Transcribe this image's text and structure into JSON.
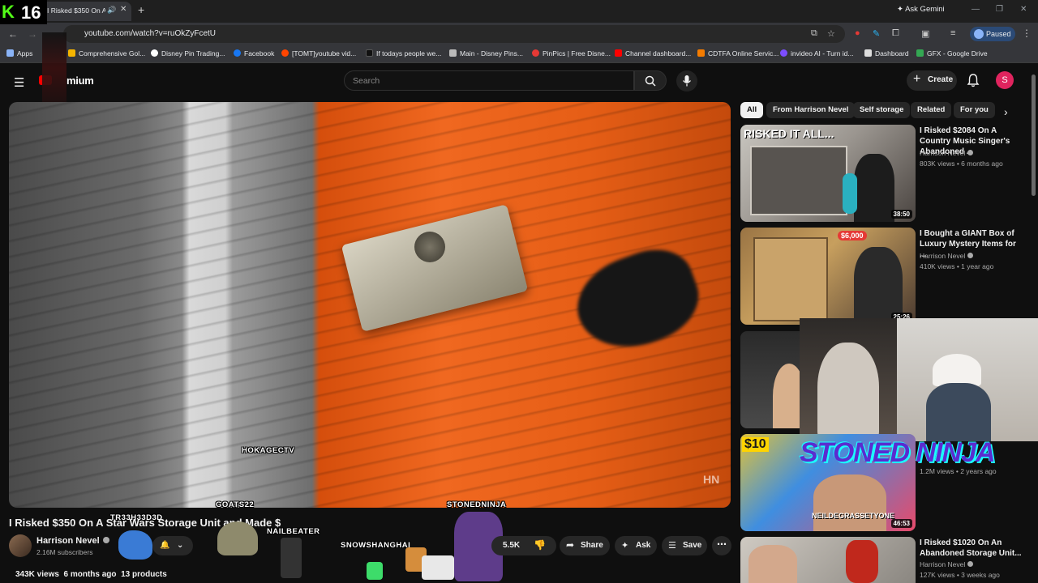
{
  "browser": {
    "tab_title": "I Risked $350 On A Star Wars",
    "ask_gemini": "Ask Gemini",
    "url": "youtube.com/watch?v=ruOkZyFcetU",
    "profile_status": "Paused",
    "bookmarks": [
      {
        "label": "Apps",
        "color": "#8ab4f8"
      },
      {
        "label": "Comprehensive Gol...",
        "color": "#f4b400"
      },
      {
        "label": "Disney Pin Trading...",
        "color": "#ffffff"
      },
      {
        "label": "Facebook",
        "color": "#1877f2"
      },
      {
        "label": "[TOMT]youtube vid...",
        "color": "#ff4500"
      },
      {
        "label": "If todays people we...",
        "color": "#111111"
      },
      {
        "label": "Main - Disney Pins...",
        "color": "#bbbbbb"
      },
      {
        "label": "PinPics | Free Disne...",
        "color": "#e53935"
      },
      {
        "label": "Channel dashboard...",
        "color": "#ff0000"
      },
      {
        "label": "CDTFA Online Servic...",
        "color": "#f57c00"
      },
      {
        "label": "invideo AI - Turn id...",
        "color": "#7c4dff"
      },
      {
        "label": "Dashboard",
        "color": "#dddddd"
      },
      {
        "label": "GFX - Google Drive",
        "color": "#34a853"
      }
    ]
  },
  "youtube": {
    "logo_text": "mium",
    "search_placeholder": "Search",
    "create_label": "Create",
    "avatar_letter": "S"
  },
  "stream": {
    "counter_icon": "K",
    "counter_value": "16",
    "names": {
      "hokage": "HOKAGECTV",
      "goats": "GOATS22",
      "stonedninja": "STONEDNINJA",
      "trash": "TR33H33D3D",
      "nailbeater": "NAILBEATER",
      "snowshanghai": "SNOWSHANGHAI",
      "neil": "NEILDEGRASSETYONE"
    },
    "banner": "STONED NINJA"
  },
  "video": {
    "title": "I Risked $350 On A Star Wars Storage Unit and Made $",
    "channel": "Harrison Nevel",
    "subscribers": "2.16M subscribers",
    "likes": "5.5K",
    "share": "Share",
    "ask": "Ask",
    "save": "Save",
    "views": "343K views",
    "age": "6 months ago",
    "products": "13 products"
  },
  "chips": [
    "All",
    "From Harrison Nevel",
    "Self storage",
    "Related",
    "For you"
  ],
  "recommendations": [
    {
      "title": "I Risked $2084 On A Country Music Singer's Abandoned ...",
      "channel": "Harrison Nevel",
      "meta": "803K views • 6 months ago",
      "duration": "38:50",
      "thumb_text": "RISKED IT ALL..."
    },
    {
      "title": "I Bought a GIANT Box of Luxury Mystery Items for ...",
      "channel": "Harrison Nevel",
      "meta": "410K views • 1 year ago",
      "duration": "25:26",
      "thumb_text": "$6,000"
    },
    {
      "title": "",
      "channel": "",
      "meta": "1.2M views • 2 years ago",
      "duration": "46:53",
      "thumb_text": "$10"
    },
    {
      "title": "I Risked $1020 On An Abandoned Storage Unit...",
      "channel": "Harrison Nevel",
      "meta": "127K views • 3 weeks ago",
      "duration": "",
      "thumb_text": ""
    }
  ]
}
